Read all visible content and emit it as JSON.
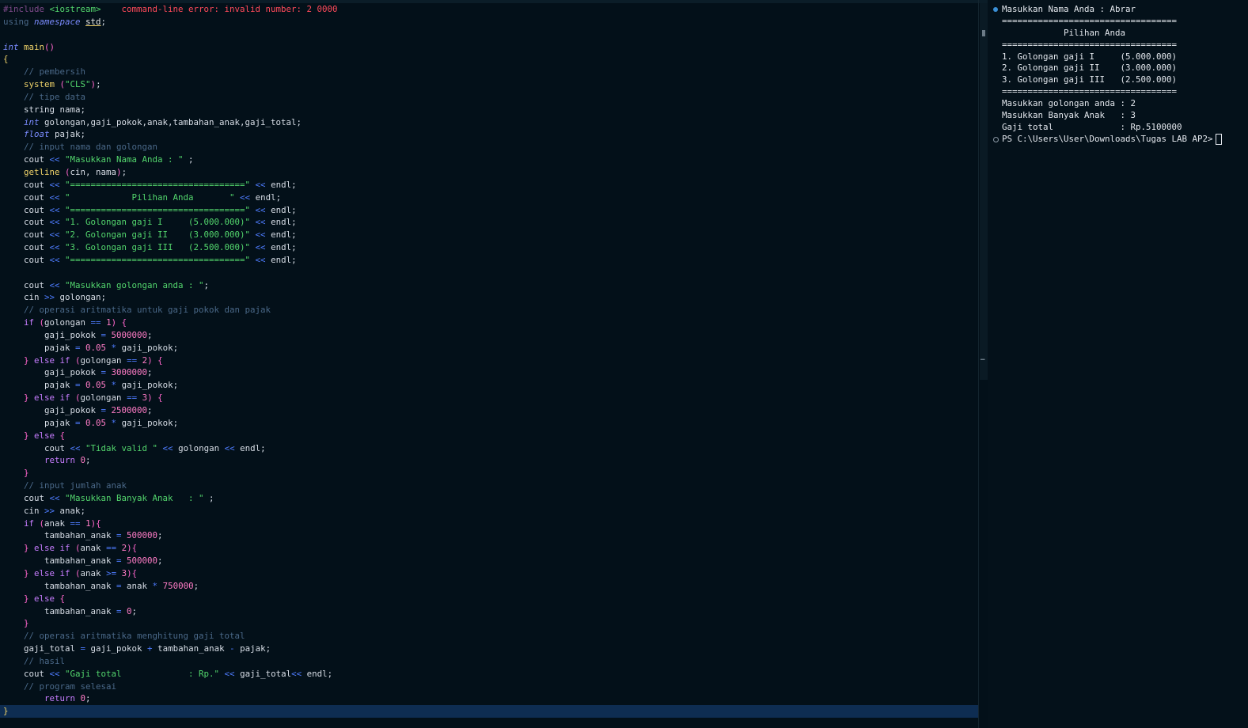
{
  "editor": {
    "lines": [
      [
        [
          "c-inc",
          "#include "
        ],
        [
          "c-incl",
          "<iostream>"
        ],
        [
          "c-err",
          "    command-line error: invalid number: 2 0000"
        ]
      ],
      [
        [
          "c-cm",
          "using "
        ],
        [
          "c-it",
          "namespace "
        ],
        [
          "c-ns",
          "std"
        ],
        [
          "c-var",
          ";"
        ]
      ],
      [],
      [
        [
          "c-it",
          "int "
        ],
        [
          "c-fn",
          "main"
        ],
        [
          "c-br",
          "()"
        ]
      ],
      [
        [
          "c-brace0",
          "{"
        ]
      ],
      [
        [
          "c-cm",
          "    // pembersih"
        ]
      ],
      [
        [
          "c-fn",
          "    system "
        ],
        [
          "c-br",
          "("
        ],
        [
          "c-str",
          "\"CLS\""
        ],
        [
          "c-br",
          ")"
        ],
        [
          "c-var",
          ";"
        ]
      ],
      [
        [
          "c-cm",
          "    // tipe data"
        ]
      ],
      [
        [
          "c-var",
          "    string nama;"
        ]
      ],
      [
        [
          "c-it",
          "    int "
        ],
        [
          "c-var",
          "golongan,gaji_pokok,anak,tambahan_anak,gaji_total;"
        ]
      ],
      [
        [
          "c-it",
          "    float "
        ],
        [
          "c-var",
          "pajak;"
        ]
      ],
      [
        [
          "c-cm",
          "    // input nama dan golongan"
        ]
      ],
      [
        [
          "c-var",
          "    cout "
        ],
        [
          "c-op",
          "<< "
        ],
        [
          "c-str",
          "\"Masukkan Nama Anda : \""
        ],
        [
          "c-var",
          " ;"
        ]
      ],
      [
        [
          "c-fn",
          "    getline "
        ],
        [
          "c-br",
          "("
        ],
        [
          "c-var",
          "cin, nama"
        ],
        [
          "c-br",
          ")"
        ],
        [
          "c-var",
          ";"
        ]
      ],
      [
        [
          "c-var",
          "    cout "
        ],
        [
          "c-op",
          "<< "
        ],
        [
          "c-str",
          "\"==================================\""
        ],
        [
          "c-op",
          " << "
        ],
        [
          "c-var",
          "endl;"
        ]
      ],
      [
        [
          "c-var",
          "    cout "
        ],
        [
          "c-op",
          "<< "
        ],
        [
          "c-str",
          "\"            Pilihan Anda       \""
        ],
        [
          "c-op",
          " << "
        ],
        [
          "c-var",
          "endl;"
        ]
      ],
      [
        [
          "c-var",
          "    cout "
        ],
        [
          "c-op",
          "<< "
        ],
        [
          "c-str",
          "\"==================================\""
        ],
        [
          "c-op",
          " << "
        ],
        [
          "c-var",
          "endl;"
        ]
      ],
      [
        [
          "c-var",
          "    cout "
        ],
        [
          "c-op",
          "<< "
        ],
        [
          "c-str",
          "\"1. Golongan gaji I     (5.000.000)\""
        ],
        [
          "c-op",
          " << "
        ],
        [
          "c-var",
          "endl;"
        ]
      ],
      [
        [
          "c-var",
          "    cout "
        ],
        [
          "c-op",
          "<< "
        ],
        [
          "c-str",
          "\"2. Golongan gaji II    (3.000.000)\""
        ],
        [
          "c-op",
          " << "
        ],
        [
          "c-var",
          "endl;"
        ]
      ],
      [
        [
          "c-var",
          "    cout "
        ],
        [
          "c-op",
          "<< "
        ],
        [
          "c-str",
          "\"3. Golongan gaji III   (2.500.000)\""
        ],
        [
          "c-op",
          " << "
        ],
        [
          "c-var",
          "endl;"
        ]
      ],
      [
        [
          "c-var",
          "    cout "
        ],
        [
          "c-op",
          "<< "
        ],
        [
          "c-str",
          "\"==================================\""
        ],
        [
          "c-op",
          " << "
        ],
        [
          "c-var",
          "endl;"
        ]
      ],
      [],
      [
        [
          "c-var",
          "    cout "
        ],
        [
          "c-op",
          "<< "
        ],
        [
          "c-str",
          "\"Masukkan golongan anda : \""
        ],
        [
          "c-var",
          ";"
        ]
      ],
      [
        [
          "c-var",
          "    cin "
        ],
        [
          "c-op",
          ">> "
        ],
        [
          "c-var",
          "golongan;"
        ]
      ],
      [
        [
          "c-cm",
          "    // operasi aritmatika untuk gaji pokok dan pajak"
        ]
      ],
      [
        [
          "c-kw",
          "    if "
        ],
        [
          "c-br",
          "("
        ],
        [
          "c-var",
          "golongan "
        ],
        [
          "c-op",
          "== "
        ],
        [
          "c-num",
          "1"
        ],
        [
          "c-br",
          ") {"
        ]
      ],
      [
        [
          "c-var",
          "        gaji_pokok "
        ],
        [
          "c-op",
          "= "
        ],
        [
          "c-num",
          "5000000"
        ],
        [
          "c-var",
          ";"
        ]
      ],
      [
        [
          "c-var",
          "        pajak "
        ],
        [
          "c-op",
          "= "
        ],
        [
          "c-num",
          "0.05 "
        ],
        [
          "c-op",
          "* "
        ],
        [
          "c-var",
          "gaji_pokok;"
        ]
      ],
      [
        [
          "c-br",
          "    } "
        ],
        [
          "c-kw",
          "else if "
        ],
        [
          "c-br",
          "("
        ],
        [
          "c-var",
          "golongan "
        ],
        [
          "c-op",
          "== "
        ],
        [
          "c-num",
          "2"
        ],
        [
          "c-br",
          ") {"
        ]
      ],
      [
        [
          "c-var",
          "        gaji_pokok "
        ],
        [
          "c-op",
          "= "
        ],
        [
          "c-num",
          "3000000"
        ],
        [
          "c-var",
          ";"
        ]
      ],
      [
        [
          "c-var",
          "        pajak "
        ],
        [
          "c-op",
          "= "
        ],
        [
          "c-num",
          "0.05 "
        ],
        [
          "c-op",
          "* "
        ],
        [
          "c-var",
          "gaji_pokok;"
        ]
      ],
      [
        [
          "c-br",
          "    } "
        ],
        [
          "c-kw",
          "else if "
        ],
        [
          "c-br",
          "("
        ],
        [
          "c-var",
          "golongan "
        ],
        [
          "c-op",
          "== "
        ],
        [
          "c-num",
          "3"
        ],
        [
          "c-br",
          ") {"
        ]
      ],
      [
        [
          "c-var",
          "        gaji_pokok "
        ],
        [
          "c-op",
          "= "
        ],
        [
          "c-num",
          "2500000"
        ],
        [
          "c-var",
          ";"
        ]
      ],
      [
        [
          "c-var",
          "        pajak "
        ],
        [
          "c-op",
          "= "
        ],
        [
          "c-num",
          "0.05 "
        ],
        [
          "c-op",
          "* "
        ],
        [
          "c-var",
          "gaji_pokok;"
        ]
      ],
      [
        [
          "c-br",
          "    } "
        ],
        [
          "c-kw",
          "else "
        ],
        [
          "c-br",
          "{"
        ]
      ],
      [
        [
          "c-var",
          "        cout "
        ],
        [
          "c-op",
          "<< "
        ],
        [
          "c-str",
          "\"Tidak valid \""
        ],
        [
          "c-op",
          " << "
        ],
        [
          "c-var",
          "golongan "
        ],
        [
          "c-op",
          "<< "
        ],
        [
          "c-var",
          "endl;"
        ]
      ],
      [
        [
          "c-kw",
          "        return "
        ],
        [
          "c-num",
          "0"
        ],
        [
          "c-var",
          ";"
        ]
      ],
      [
        [
          "c-br",
          "    }"
        ]
      ],
      [
        [
          "c-cm",
          "    // input jumlah anak"
        ]
      ],
      [
        [
          "c-var",
          "    cout "
        ],
        [
          "c-op",
          "<< "
        ],
        [
          "c-str",
          "\"Masukkan Banyak Anak   : \""
        ],
        [
          "c-var",
          " ;"
        ]
      ],
      [
        [
          "c-var",
          "    cin "
        ],
        [
          "c-op",
          ">> "
        ],
        [
          "c-var",
          "anak;"
        ]
      ],
      [
        [
          "c-kw",
          "    if "
        ],
        [
          "c-br",
          "("
        ],
        [
          "c-var",
          "anak "
        ],
        [
          "c-op",
          "== "
        ],
        [
          "c-num",
          "1"
        ],
        [
          "c-br",
          "){"
        ]
      ],
      [
        [
          "c-var",
          "        tambahan_anak "
        ],
        [
          "c-op",
          "= "
        ],
        [
          "c-num",
          "500000"
        ],
        [
          "c-var",
          ";"
        ]
      ],
      [
        [
          "c-br",
          "    } "
        ],
        [
          "c-kw",
          "else if "
        ],
        [
          "c-br",
          "("
        ],
        [
          "c-var",
          "anak "
        ],
        [
          "c-op",
          "== "
        ],
        [
          "c-num",
          "2"
        ],
        [
          "c-br",
          "){"
        ]
      ],
      [
        [
          "c-var",
          "        tambahan_anak "
        ],
        [
          "c-op",
          "= "
        ],
        [
          "c-num",
          "500000"
        ],
        [
          "c-var",
          ";"
        ]
      ],
      [
        [
          "c-br",
          "    } "
        ],
        [
          "c-kw",
          "else if "
        ],
        [
          "c-br",
          "("
        ],
        [
          "c-var",
          "anak "
        ],
        [
          "c-op",
          ">= "
        ],
        [
          "c-num",
          "3"
        ],
        [
          "c-br",
          "){"
        ]
      ],
      [
        [
          "c-var",
          "        tambahan_anak "
        ],
        [
          "c-op",
          "= "
        ],
        [
          "c-var",
          "anak "
        ],
        [
          "c-op",
          "* "
        ],
        [
          "c-num",
          "750000"
        ],
        [
          "c-var",
          ";"
        ]
      ],
      [
        [
          "c-br",
          "    } "
        ],
        [
          "c-kw",
          "else "
        ],
        [
          "c-br",
          "{"
        ]
      ],
      [
        [
          "c-var",
          "        tambahan_anak "
        ],
        [
          "c-op",
          "= "
        ],
        [
          "c-num",
          "0"
        ],
        [
          "c-var",
          ";"
        ]
      ],
      [
        [
          "c-br",
          "    }"
        ]
      ],
      [
        [
          "c-cm",
          "    // operasi aritmatika menghitung gaji total"
        ]
      ],
      [
        [
          "c-var",
          "    gaji_total "
        ],
        [
          "c-op",
          "= "
        ],
        [
          "c-var",
          "gaji_pokok "
        ],
        [
          "c-op",
          "+ "
        ],
        [
          "c-var",
          "tambahan_anak "
        ],
        [
          "c-op",
          "- "
        ],
        [
          "c-var",
          "pajak;"
        ]
      ],
      [
        [
          "c-cm",
          "    // hasil"
        ]
      ],
      [
        [
          "c-var",
          "    cout "
        ],
        [
          "c-op",
          "<< "
        ],
        [
          "c-str",
          "\"Gaji total             : Rp.\""
        ],
        [
          "c-op",
          " << "
        ],
        [
          "c-var",
          "gaji_total"
        ],
        [
          "c-op",
          "<< "
        ],
        [
          "c-var",
          "endl;"
        ]
      ],
      [
        [
          "c-cm",
          "    // program selesai"
        ]
      ],
      [
        [
          "c-kw",
          "        return "
        ],
        [
          "c-num",
          "0"
        ],
        [
          "c-var",
          ";"
        ]
      ],
      [
        [
          "c-brace0",
          "}"
        ]
      ]
    ]
  },
  "terminal": {
    "lines": [
      "Masukkan Nama Anda : Abrar",
      "==================================",
      "            Pilihan Anda",
      "==================================",
      "1. Golongan gaji I     (5.000.000)",
      "2. Golongan gaji II    (3.000.000)",
      "3. Golongan gaji III   (2.500.000)",
      "==================================",
      "Masukkan golongan anda : 2",
      "Masukkan Banyak Anak   : 3",
      "Gaji total             : Rp.5100000"
    ],
    "prompt": "PS C:\\Users\\User\\Downloads\\Tugas LAB AP2>"
  }
}
